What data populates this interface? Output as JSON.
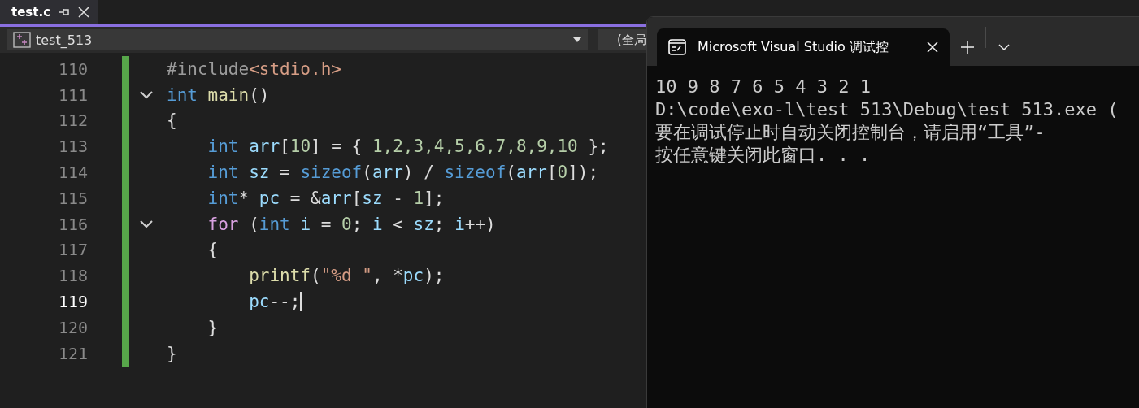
{
  "editor_tab": {
    "title": "test.c",
    "selected": true
  },
  "nav_bar": {
    "project": "test_513",
    "scope": "(全局"
  },
  "code": {
    "lines": [
      {
        "number": "110",
        "fold": false,
        "current": false,
        "tokens": [
          {
            "kind": "preproc",
            "text": "#include"
          },
          {
            "kind": "string",
            "text": "<stdio.h>"
          }
        ]
      },
      {
        "number": "111",
        "fold": true,
        "current": false,
        "tokens": [
          {
            "kind": "keyword",
            "text": "int"
          },
          {
            "kind": "func",
            "text": " main"
          },
          {
            "kind": "plain",
            "text": "()"
          }
        ]
      },
      {
        "number": "112",
        "fold": false,
        "current": false,
        "tokens": [
          {
            "kind": "plain",
            "text": "{"
          }
        ]
      },
      {
        "number": "113",
        "fold": false,
        "current": false,
        "tokens": [
          {
            "kind": "keyword",
            "text": "    int"
          },
          {
            "kind": "ident",
            "text": " arr"
          },
          {
            "kind": "plain",
            "text": "["
          },
          {
            "kind": "number",
            "text": "10"
          },
          {
            "kind": "plain",
            "text": "] = { "
          },
          {
            "kind": "number",
            "text": "1,2,3,4,5,6,7,8,9,10"
          },
          {
            "kind": "plain",
            "text": " };"
          }
        ]
      },
      {
        "number": "114",
        "fold": false,
        "current": false,
        "tokens": [
          {
            "kind": "keyword",
            "text": "    int"
          },
          {
            "kind": "ident",
            "text": " sz"
          },
          {
            "kind": "plain",
            "text": " = "
          },
          {
            "kind": "keyword",
            "text": "sizeof"
          },
          {
            "kind": "plain",
            "text": "("
          },
          {
            "kind": "ident",
            "text": "arr"
          },
          {
            "kind": "plain",
            "text": ") / "
          },
          {
            "kind": "keyword",
            "text": "sizeof"
          },
          {
            "kind": "plain",
            "text": "("
          },
          {
            "kind": "ident",
            "text": "arr"
          },
          {
            "kind": "plain",
            "text": "["
          },
          {
            "kind": "number",
            "text": "0"
          },
          {
            "kind": "plain",
            "text": "]);"
          }
        ]
      },
      {
        "number": "115",
        "fold": false,
        "current": false,
        "tokens": [
          {
            "kind": "keyword",
            "text": "    int"
          },
          {
            "kind": "plain",
            "text": "* "
          },
          {
            "kind": "ident",
            "text": "pc"
          },
          {
            "kind": "plain",
            "text": " = &"
          },
          {
            "kind": "ident",
            "text": "arr"
          },
          {
            "kind": "plain",
            "text": "["
          },
          {
            "kind": "ident",
            "text": "sz"
          },
          {
            "kind": "plain",
            "text": " - "
          },
          {
            "kind": "number",
            "text": "1"
          },
          {
            "kind": "plain",
            "text": "];"
          }
        ]
      },
      {
        "number": "116",
        "fold": true,
        "current": false,
        "tokens": [
          {
            "kind": "control",
            "text": "    for"
          },
          {
            "kind": "plain",
            "text": " ("
          },
          {
            "kind": "keyword",
            "text": "int"
          },
          {
            "kind": "ident",
            "text": " i"
          },
          {
            "kind": "plain",
            "text": " = "
          },
          {
            "kind": "number",
            "text": "0"
          },
          {
            "kind": "plain",
            "text": "; "
          },
          {
            "kind": "ident",
            "text": "i"
          },
          {
            "kind": "plain",
            "text": " < "
          },
          {
            "kind": "ident",
            "text": "sz"
          },
          {
            "kind": "plain",
            "text": "; "
          },
          {
            "kind": "ident",
            "text": "i"
          },
          {
            "kind": "plain",
            "text": "++)"
          }
        ]
      },
      {
        "number": "117",
        "fold": false,
        "current": false,
        "tokens": [
          {
            "kind": "plain",
            "text": "    {"
          }
        ]
      },
      {
        "number": "118",
        "fold": false,
        "current": false,
        "tokens": [
          {
            "kind": "func",
            "text": "        printf"
          },
          {
            "kind": "plain",
            "text": "("
          },
          {
            "kind": "string",
            "text": "\"%d \""
          },
          {
            "kind": "plain",
            "text": ", *"
          },
          {
            "kind": "ident",
            "text": "pc"
          },
          {
            "kind": "plain",
            "text": ");"
          }
        ]
      },
      {
        "number": "119",
        "fold": false,
        "current": true,
        "tokens": [
          {
            "kind": "ident",
            "text": "        pc"
          },
          {
            "kind": "plain",
            "text": "--;"
          }
        ]
      },
      {
        "number": "120",
        "fold": false,
        "current": false,
        "tokens": [
          {
            "kind": "plain",
            "text": "    }"
          }
        ]
      },
      {
        "number": "121",
        "fold": false,
        "current": false,
        "tokens": [
          {
            "kind": "plain",
            "text": "}"
          }
        ]
      }
    ]
  },
  "console": {
    "tab_title": "Microsoft Visual Studio 调试控",
    "lines": [
      "10 9 8 7 6 5 4 3 2 1",
      "D:\\code\\exo-l\\test_513\\Debug\\test_513.exe (",
      "要在调试停止时自动关闭控制台，请启用“工具”-",
      "按任意键关闭此窗口. . ."
    ]
  }
}
